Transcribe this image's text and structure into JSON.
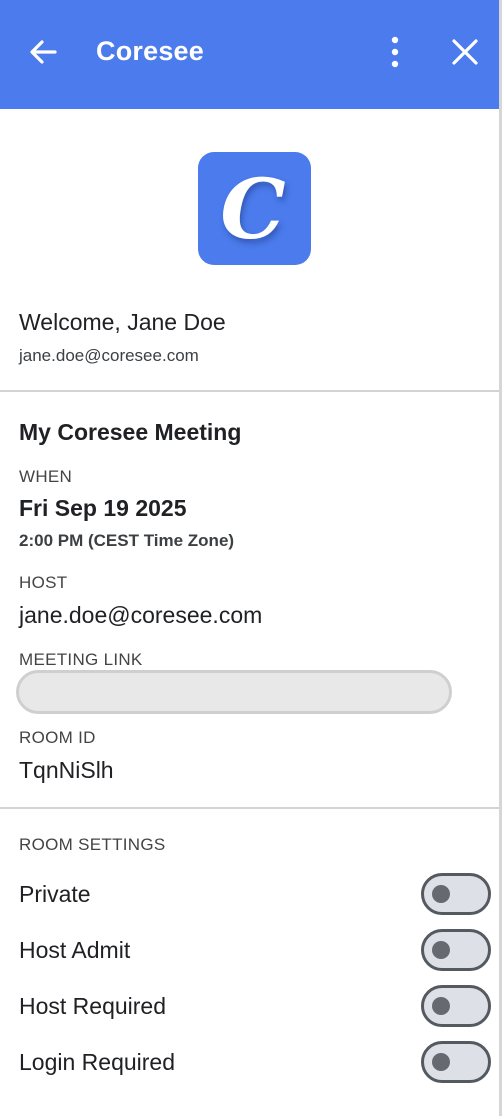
{
  "header": {
    "title": "Coresee",
    "background": "#4b7bec",
    "back_icon": "arrow-left-icon",
    "more_icon": "more-vertical-icon",
    "close_icon": "close-icon"
  },
  "logo": {
    "letter": "C",
    "color": "#4b7bec"
  },
  "user": {
    "welcome": "Welcome, Jane Doe",
    "email": "jane.doe@coresee.com"
  },
  "meeting": {
    "title": "My Coresee Meeting",
    "when_label": "WHEN",
    "date": "Fri Sep 19 2025",
    "time": "2:00 PM (CEST Time Zone)",
    "host_label": "HOST",
    "host": "jane.doe@coresee.com",
    "link_label": "MEETING LINK",
    "link_value": "",
    "room_id_label": "ROOM ID",
    "room_id": "TqnNiSlh"
  },
  "settings": {
    "heading": "ROOM SETTINGS",
    "toggles": [
      {
        "label": "Private",
        "on": false
      },
      {
        "label": "Host Admit",
        "on": false
      },
      {
        "label": "Host Required",
        "on": false
      },
      {
        "label": "Login Required",
        "on": false
      }
    ]
  }
}
